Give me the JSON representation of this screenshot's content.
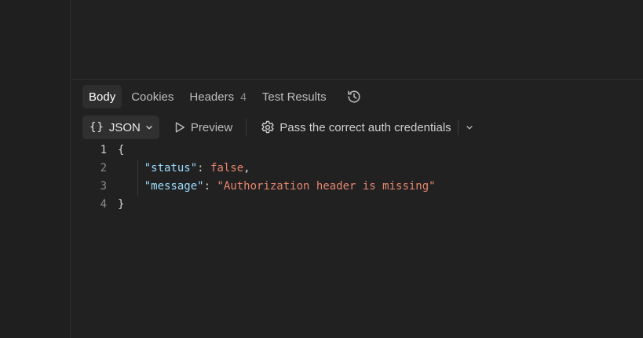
{
  "tabs": [
    {
      "label": "Body",
      "active": true
    },
    {
      "label": "Cookies",
      "active": false
    },
    {
      "label": "Headers",
      "count": "4",
      "active": false
    },
    {
      "label": "Test Results",
      "active": false
    }
  ],
  "history_icon": "history-icon",
  "toolbar": {
    "format_braces": "{}",
    "format_label": "JSON",
    "preview_label": "Preview",
    "auth_label": "Pass the correct auth credentials"
  },
  "code": {
    "line_numbers": [
      "1",
      "2",
      "3",
      "4"
    ],
    "open_brace": "{",
    "close_brace": "}",
    "status_key": "\"status\"",
    "status_value": "false",
    "message_key": "\"message\"",
    "message_value": "\"Authorization header is missing\""
  },
  "colors": {
    "background": "#212121",
    "key": "#9cdcfe",
    "value": "#e5866e",
    "active_tab_bg": "#2e2e2e"
  }
}
